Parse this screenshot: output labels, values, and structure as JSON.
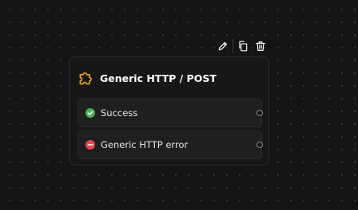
{
  "node": {
    "title": "Generic HTTP / POST",
    "icon": "puzzle-piece-icon",
    "accent_color": "#f5a623",
    "outlets": [
      {
        "label": "Success",
        "status": "success",
        "icon": "check-circle-icon",
        "color": "#4caf50"
      },
      {
        "label": "Generic HTTP error",
        "status": "error",
        "icon": "minus-circle-icon",
        "color": "#e5484d"
      }
    ]
  },
  "toolbar": {
    "actions": [
      {
        "name": "edit",
        "icon": "pencil-icon"
      },
      {
        "name": "duplicate",
        "icon": "copy-icon"
      },
      {
        "name": "delete",
        "icon": "trash-icon"
      }
    ]
  }
}
